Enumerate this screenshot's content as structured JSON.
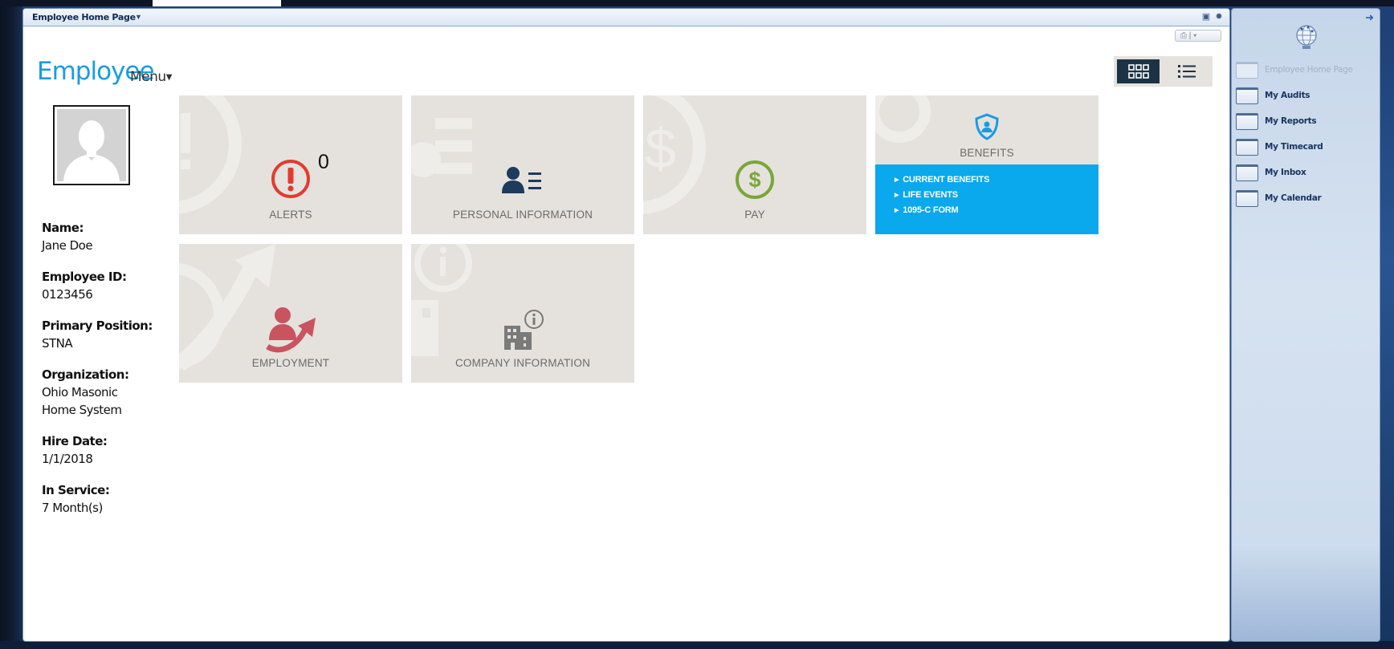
{
  "window": {
    "title": "Employee Home Page"
  },
  "header": {
    "title": "Employee",
    "menu_label": "Menu"
  },
  "profile": {
    "fields": [
      {
        "label": "Name:",
        "value": "Jane Doe"
      },
      {
        "label": "Employee ID:",
        "value": "0123456"
      },
      {
        "label": "Primary Position:",
        "value": "STNA"
      },
      {
        "label": "Organization:",
        "value": "Ohio Masonic Home System"
      },
      {
        "label": "Hire Date:",
        "value": "1/1/2018"
      },
      {
        "label": "In Service:",
        "value": "7 Month(s)"
      }
    ]
  },
  "tiles": {
    "alerts": {
      "label": "ALERTS",
      "count": "0"
    },
    "personal": {
      "label": "PERSONAL INFORMATION"
    },
    "pay": {
      "label": "PAY"
    },
    "benefits": {
      "label": "BENEFITS",
      "links": [
        "CURRENT BENEFITS",
        "LIFE EVENTS",
        "1095-C FORM"
      ]
    },
    "employment": {
      "label": "EMPLOYMENT"
    },
    "company": {
      "label": "COMPANY INFORMATION"
    }
  },
  "sidebar": {
    "items": [
      {
        "label": "Employee Home Page",
        "active": false
      },
      {
        "label": "My Audits"
      },
      {
        "label": "My Reports"
      },
      {
        "label": "My Timecard"
      },
      {
        "label": "My Inbox"
      },
      {
        "label": "My Calendar"
      }
    ]
  },
  "colors": {
    "accent": "#1a9be0",
    "benefits_menu": "#0aa8ec",
    "tile_bg": "#e5e2dd",
    "alert_red": "#e33b2e",
    "pay_green": "#7aa63a",
    "employment_rose": "#c9545f",
    "personal_navy": "#1e3a5c"
  }
}
